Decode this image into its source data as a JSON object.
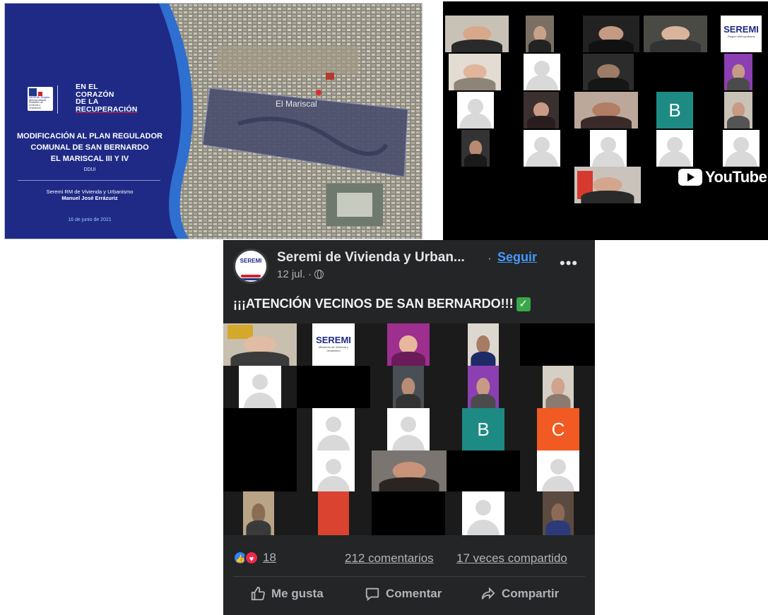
{
  "slide": {
    "campaign_lines": [
      "EN EL",
      "CORAZÓN",
      "DE LA",
      "RECUPERACIÓN"
    ],
    "title_lines": [
      "MODIFICACIÓN AL PLAN REGULADOR",
      "COMUNAL DE SAN BERNARDO",
      "EL MARISCAL III Y IV"
    ],
    "code": "DDUI",
    "org": "Seremi RM de Vivienda y Urbanismo",
    "person": "Manuel José Errázuriz",
    "date": "16 de junio de 2021",
    "map_label": "El Mariscal",
    "badge_text": "SEREMI Región Metropolitana",
    "badge_sub": "Ministerio de Vivienda y Urbanismo"
  },
  "zoom": {
    "letter_tile": "B",
    "logo_tile": "SEREMI",
    "logo_sub": "Región Metropolitana",
    "stream_label": "YouTube"
  },
  "post": {
    "page_name": "Seremi de Vivienda y Urban...",
    "separator": "·",
    "follow": "Seguir",
    "more": "•••",
    "date": "12 jul.",
    "date_sep": "·",
    "avatar_text": "SEREMI",
    "text": "¡¡¡ATENCIÓN VECINOS DE SAN BERNARDO!!!",
    "check": "✓",
    "media_letter_b": "B",
    "media_letter_c": "C",
    "media_logo": "SEREMI",
    "media_logo_sub": "Ministerio de Vivienda y Urbanismo",
    "reaction_count": "18",
    "comments": "212 comentarios",
    "shares": "17 veces compartido",
    "actions": {
      "like": "Me gusta",
      "comment": "Comentar",
      "share": "Compartir"
    }
  },
  "colors": {
    "slide_navy": "#1f2a86",
    "slide_accent": "#2e6fd0",
    "fb_bg": "#242526",
    "fb_link": "#4599ff",
    "tile_teal": "#1e8a84",
    "tile_orange": "#f15a22"
  }
}
